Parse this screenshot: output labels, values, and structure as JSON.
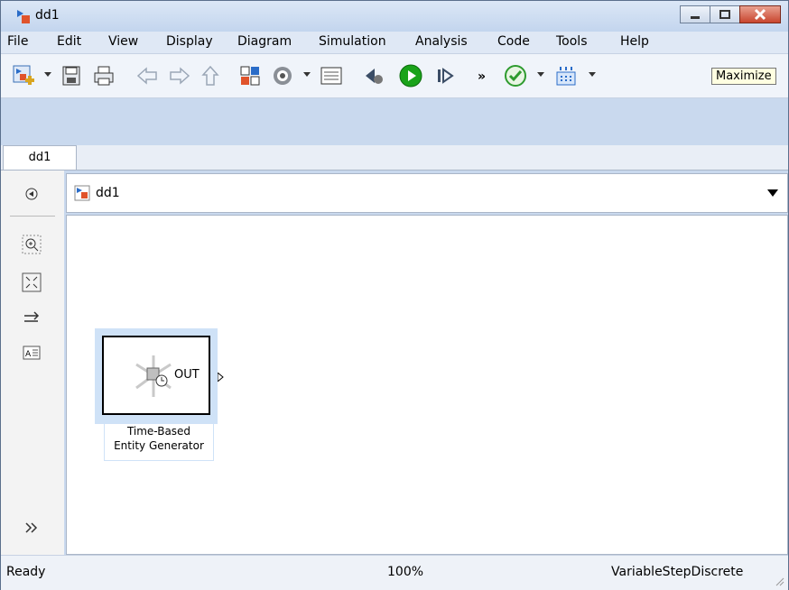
{
  "window": {
    "title": "dd1",
    "minimize_tip": "Maximize"
  },
  "menu": [
    "File",
    "Edit",
    "View",
    "Display",
    "Diagram",
    "Simulation",
    "Analysis",
    "Code",
    "Tools",
    "Help"
  ],
  "tab": {
    "label": "dd1"
  },
  "address": {
    "path": "dd1"
  },
  "block": {
    "port_label": "OUT",
    "name_line1": "Time-Based",
    "name_line2": "Entity Generator"
  },
  "status": {
    "state": "Ready",
    "zoom": "100%",
    "solver": "VariableStepDiscrete"
  },
  "icons": {
    "app": "simulink-model-icon",
    "colors": {
      "close": "#c8452e",
      "run": "#1aa31a",
      "check": "#2e9b2e"
    }
  }
}
